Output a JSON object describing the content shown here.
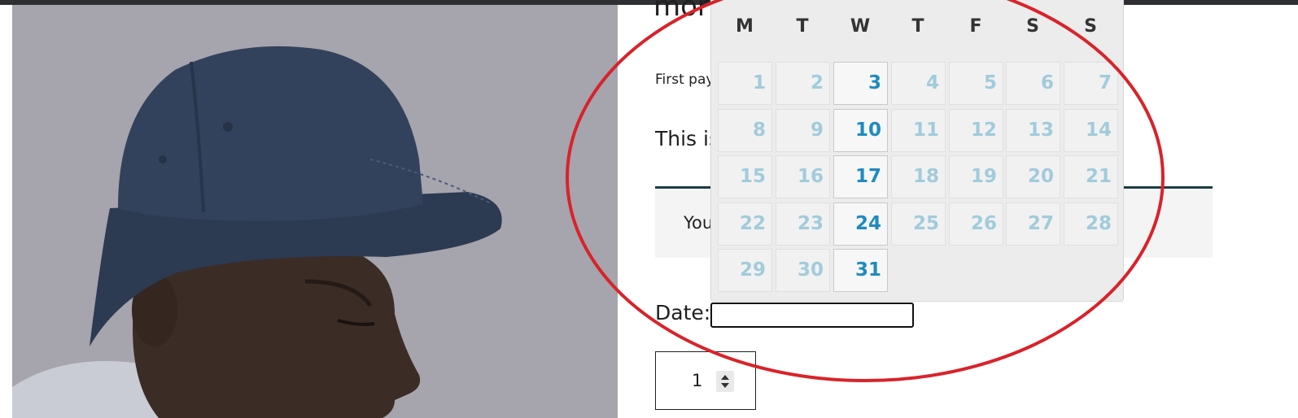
{
  "product": {
    "title_partial": "mor",
    "first_payment_partial": "First pay",
    "description_partial": "This is",
    "notice_partial": "You"
  },
  "form": {
    "date_label": "Date:",
    "date_value": "",
    "quantity": "1"
  },
  "calendar": {
    "weekdays": [
      "M",
      "T",
      "W",
      "T",
      "F",
      "S",
      "S"
    ],
    "weeks": [
      [
        "1",
        "2",
        "3",
        "4",
        "5",
        "6",
        "7"
      ],
      [
        "8",
        "9",
        "10",
        "11",
        "12",
        "13",
        "14"
      ],
      [
        "15",
        "16",
        "17",
        "18",
        "19",
        "20",
        "21"
      ],
      [
        "22",
        "23",
        "24",
        "25",
        "26",
        "27",
        "28"
      ],
      [
        "29",
        "30",
        "31"
      ]
    ],
    "enabled_days": [
      "3",
      "10",
      "17",
      "24",
      "31"
    ],
    "colors": {
      "enabled": "#1f8bbf",
      "disabled": "#a2cbdb",
      "annotation": "#d8232a"
    }
  }
}
